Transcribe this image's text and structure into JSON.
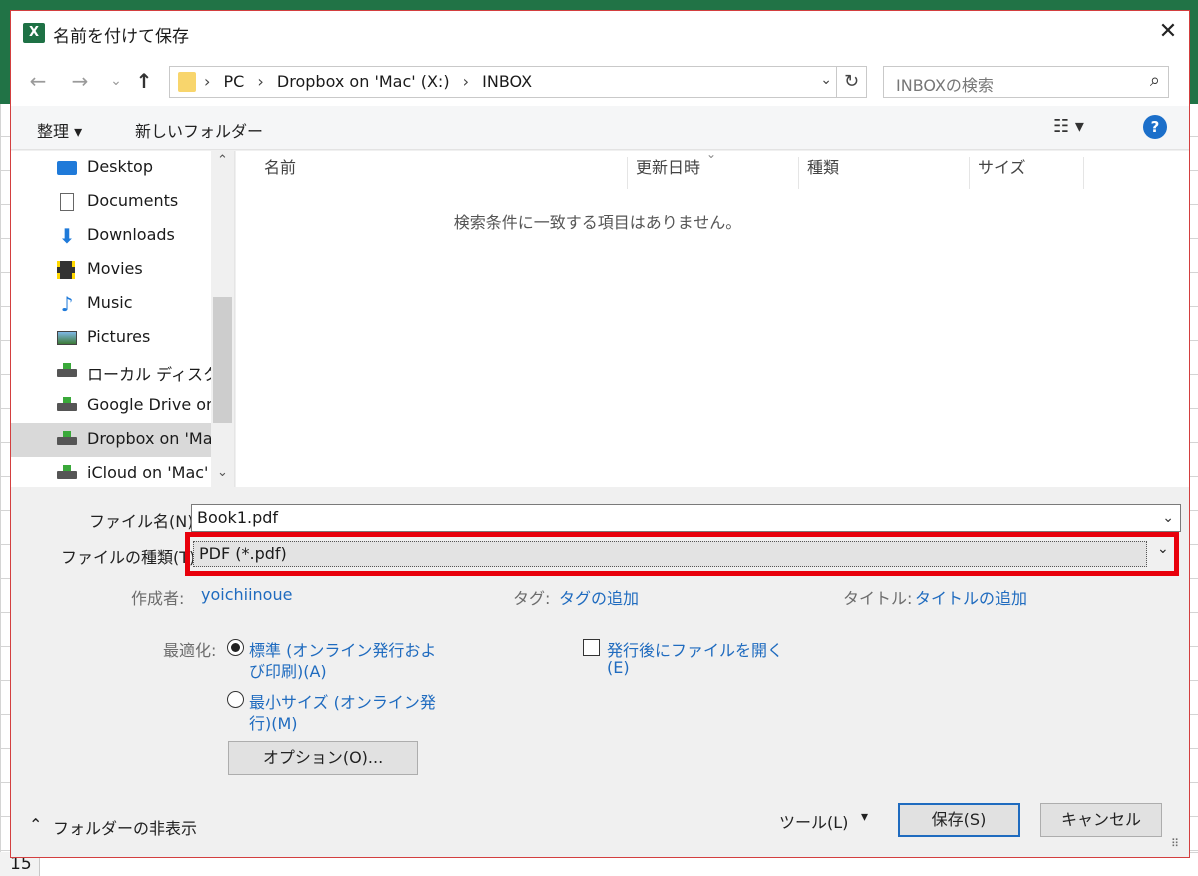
{
  "titlebar": {
    "app_icon": "X",
    "title": "名前を付けて保存",
    "close": "✕"
  },
  "nav": {
    "back": "←",
    "forward": "→",
    "recent": "⌄",
    "up": "↑",
    "breadcrumbs": [
      "PC",
      "Dropbox on 'Mac' (X:)",
      "INBOX"
    ],
    "separator": "›",
    "refresh": "↻",
    "search_placeholder": "INBOXの検索",
    "search_icon": "⌕"
  },
  "toolbar": {
    "organize": "整理 ▾",
    "new_folder": "新しいフォルダー",
    "view": "☷ ▾",
    "help": "?"
  },
  "sidebar": {
    "items": [
      {
        "label": "Desktop",
        "icon": "desktop-icon"
      },
      {
        "label": "Documents",
        "icon": "documents-icon"
      },
      {
        "label": "Downloads",
        "icon": "downloads-icon"
      },
      {
        "label": "Movies",
        "icon": "movies-icon"
      },
      {
        "label": "Music",
        "icon": "music-icon"
      },
      {
        "label": "Pictures",
        "icon": "pictures-icon"
      },
      {
        "label": "ローカル ディスク (C",
        "icon": "local-disk-icon"
      },
      {
        "label": "Google Drive on",
        "icon": "network-drive-icon"
      },
      {
        "label": "Dropbox on 'Ma",
        "icon": "network-drive-icon"
      },
      {
        "label": "iCloud on 'Mac'",
        "icon": "network-drive-icon"
      }
    ],
    "selected": "Dropbox on 'Ma"
  },
  "filelist": {
    "columns": [
      "名前",
      "更新日時",
      "種類",
      "サイズ"
    ],
    "empty_message": "検索条件に一致する項目はありません。"
  },
  "form": {
    "filename_label": "ファイル名(N):",
    "filename_value": "Book1.pdf",
    "filetype_label": "ファイルの種類(T):",
    "filetype_value": "PDF (*.pdf)",
    "author_label": "作成者:",
    "author_value": "yoichiinoue",
    "tags_label": "タグ:",
    "tags_value": "タグの追加",
    "title_label": "タイトル:",
    "title_value": "タイトルの追加",
    "optimize_label": "最適化:",
    "optimize_standard_line1": "標準 (オンライン発行およ",
    "optimize_standard_line2": "び印刷)(A)",
    "optimize_minimum_line1": "最小サイズ (オンライン発",
    "optimize_minimum_line2": "行)(M)",
    "optimize_selected": "standard",
    "open_after_line1": "発行後にファイルを開く",
    "open_after_line2": "(E)",
    "open_after_checked": false,
    "options_button": "オプション(O)..."
  },
  "footer": {
    "hide_folders": "フォルダーの非表示",
    "tools": "ツール(L)",
    "tools_arrow": "▾",
    "save": "保存(S)",
    "cancel": "キャンセル"
  },
  "background": {
    "row_number": "15"
  },
  "colors": {
    "accent": "#1f6bbf",
    "highlight": "#e8000b",
    "excel_green": "#217346"
  }
}
